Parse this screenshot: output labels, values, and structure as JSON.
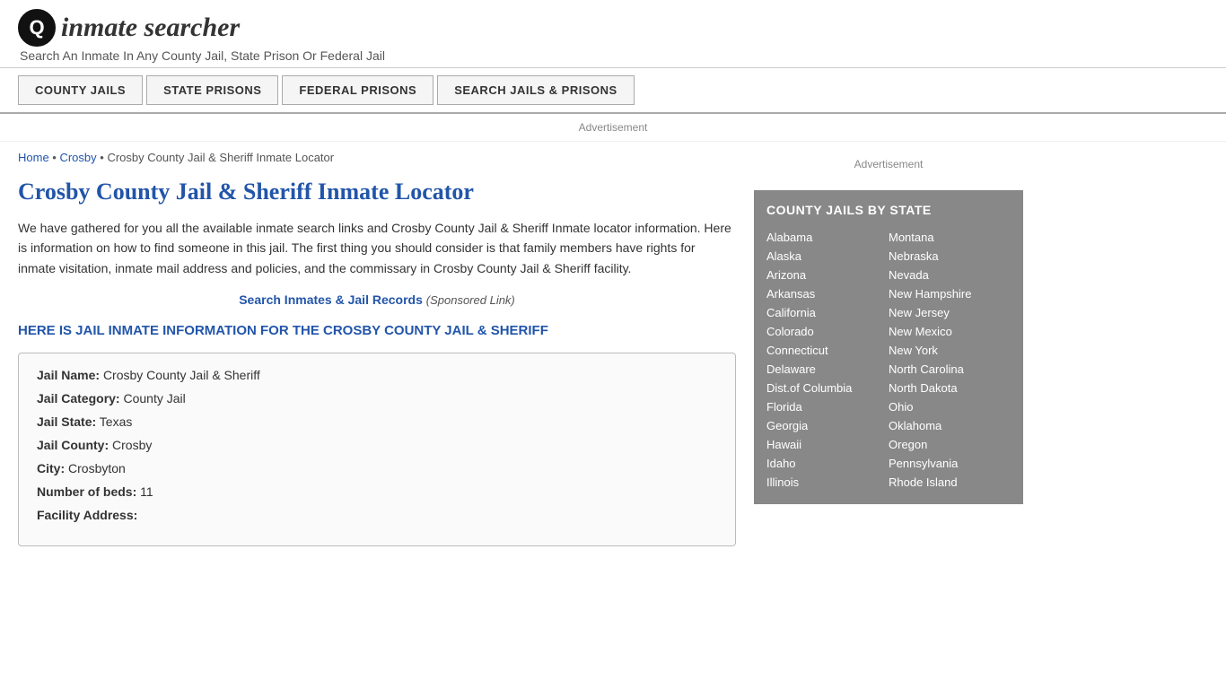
{
  "header": {
    "logo_icon": "🔍",
    "logo_text": "inmate searcher",
    "tagline": "Search An Inmate In Any County Jail, State Prison Or Federal Jail"
  },
  "nav": {
    "items": [
      {
        "label": "COUNTY JAILS",
        "name": "county-jails-nav"
      },
      {
        "label": "STATE PRISONS",
        "name": "state-prisons-nav"
      },
      {
        "label": "FEDERAL PRISONS",
        "name": "federal-prisons-nav"
      },
      {
        "label": "SEARCH JAILS & PRISONS",
        "name": "search-jails-nav"
      }
    ]
  },
  "ad_bar": "Advertisement",
  "breadcrumb": {
    "home": "Home",
    "sep1": " • ",
    "crosby": "Crosby",
    "sep2": " • ",
    "current": "Crosby County Jail & Sheriff Inmate Locator"
  },
  "page_title": "Crosby County Jail & Sheriff Inmate Locator",
  "intro_text": "We have gathered for you all the available inmate search links and Crosby County Jail & Sheriff Inmate locator information. Here is information on how to find someone in this jail. The first thing you should consider is that family members have rights for inmate visitation, inmate mail address and policies, and the commissary in Crosby County Jail & Sheriff facility.",
  "search_link_label": "Search Inmates & Jail Records",
  "sponsored_label": "(Sponsored Link)",
  "section_heading": "HERE IS JAIL INMATE INFORMATION FOR THE CROSBY COUNTY JAIL & SHERIFF",
  "info": {
    "jail_name_label": "Jail Name:",
    "jail_name_value": "Crosby County Jail & Sheriff",
    "jail_category_label": "Jail Category:",
    "jail_category_value": "County Jail",
    "jail_state_label": "Jail State:",
    "jail_state_value": "Texas",
    "jail_county_label": "Jail County:",
    "jail_county_value": "Crosby",
    "city_label": "City:",
    "city_value": "Crosbyton",
    "beds_label": "Number of beds:",
    "beds_value": "11",
    "address_label": "Facility Address:"
  },
  "sidebar": {
    "ad_label": "Advertisement",
    "state_box_title": "COUNTY JAILS BY STATE",
    "states_left": [
      "Alabama",
      "Alaska",
      "Arizona",
      "Arkansas",
      "California",
      "Colorado",
      "Connecticut",
      "Delaware",
      "Dist.of Columbia",
      "Florida",
      "Georgia",
      "Hawaii",
      "Idaho",
      "Illinois"
    ],
    "states_right": [
      "Montana",
      "Nebraska",
      "Nevada",
      "New Hampshire",
      "New Jersey",
      "New Mexico",
      "New York",
      "North Carolina",
      "North Dakota",
      "Ohio",
      "Oklahoma",
      "Oregon",
      "Pennsylvania",
      "Rhode Island"
    ]
  }
}
